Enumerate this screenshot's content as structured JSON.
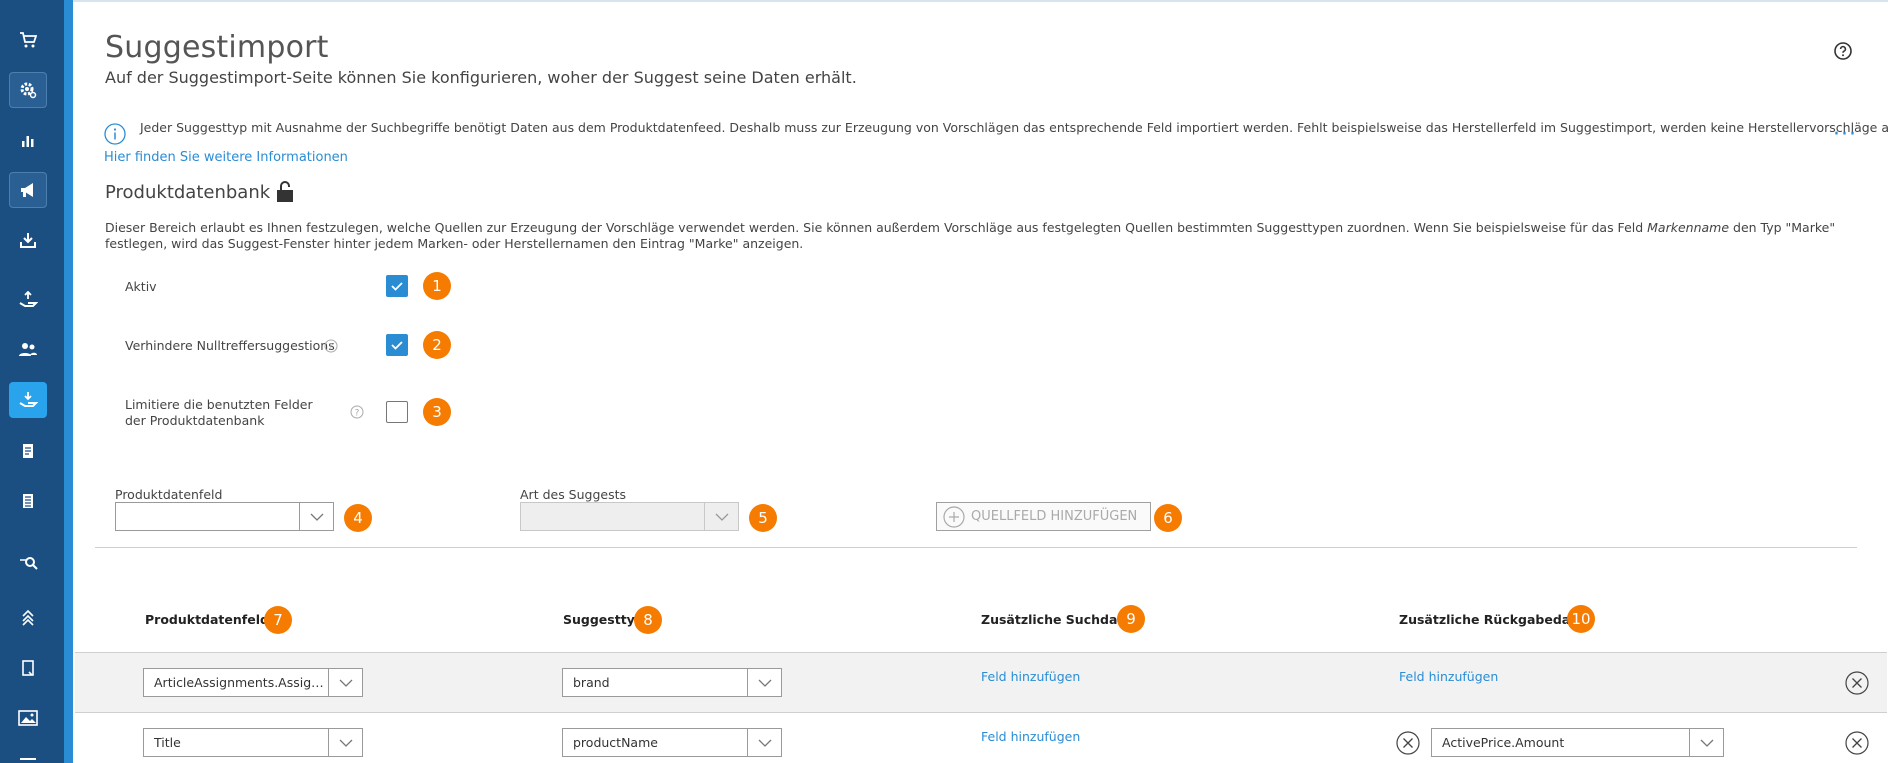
{
  "colors": {
    "sidebar": "#1b4f82",
    "accent": "#2a8dd4",
    "badge": "#f57c00",
    "active_nav": "#29a3ec"
  },
  "sidebar": {
    "items": [
      {
        "icon": "cart-icon"
      },
      {
        "icon": "settings-gear-icon"
      },
      {
        "icon": "bar-chart-icon"
      },
      {
        "icon": "megaphone-icon"
      },
      {
        "icon": "download-tray-icon"
      },
      {
        "icon": "hand-upload-icon"
      },
      {
        "icon": "users-icon"
      },
      {
        "icon": "hand-download-icon"
      },
      {
        "icon": "document-icon"
      },
      {
        "icon": "document-lines-icon"
      },
      {
        "icon": "search-tag-icon"
      },
      {
        "icon": "chevrons-up-icon"
      },
      {
        "icon": "page-icon"
      },
      {
        "icon": "image-icon"
      },
      {
        "icon": "list-icon"
      }
    ]
  },
  "header": {
    "title": "Suggestimport",
    "subtitle": "Auf der Suggestimport-Seite können Sie konfigurieren, woher der Suggest seine Daten erhält."
  },
  "info": {
    "text": "Jeder Suggesttyp mit Ausnahme der Suchbegriffe benötigt Daten aus dem Produktdatenfeed. Deshalb muss zur Erzeugung von Vorschlägen das entsprechende Feld importiert werden. Fehlt beispielsweise das Herstellerfeld im Suggestimport, werden keine Herstellervorschläge angezeigt.",
    "link": "Hier finden Sie weitere Informationen"
  },
  "section": {
    "title": "Produktdatenbank",
    "desc_part1": "Dieser Bereich erlaubt es Ihnen festzulegen, welche Quellen zur Erzeugung der Vorschläge verwendet werden. Sie können außerdem Vorschläge aus festgelegten Quellen bestimmten Suggesttypen zuordnen. Wenn Sie beispielsweise für das Feld ",
    "desc_italic": "Markenname",
    "desc_part2": " den Typ \"Marke\" festlegen, wird das Suggest-Fenster hinter jedem Marken- oder Herstellernamen den Eintrag \"Marke\" anzeigen."
  },
  "options": [
    {
      "label": "Aktiv",
      "checked": true,
      "badge": "1"
    },
    {
      "label": "Verhindere Nulltreffersuggestions",
      "checked": true,
      "badge": "2"
    },
    {
      "label": "Limitiere die benutzten Felder der Produktdatenbank",
      "checked": false,
      "badge": "3"
    }
  ],
  "add_form": {
    "field_label": "Produktdatenfeld",
    "field_value": "",
    "field_badge": "4",
    "type_label": "Art des Suggests",
    "type_value": "",
    "type_badge": "5",
    "add_button": "QUELLFELD HINZUFÜGEN",
    "add_badge": "6"
  },
  "table": {
    "columns": [
      {
        "label": "Produktdatenfeld",
        "badge": "7"
      },
      {
        "label": "Suggesttyp",
        "badge": "8"
      },
      {
        "label": "Zusätzliche Suchdaten",
        "badge": "9"
      },
      {
        "label": "Zusätzliche Rückgabedaten",
        "badge": "10"
      }
    ],
    "rows": [
      {
        "field": "ArticleAssignments.AssignmentName",
        "type": "brand",
        "search_link": "Feld hinzufügen",
        "return_link": "Feld hinzufügen"
      },
      {
        "field": "Title",
        "type": "productName",
        "search_link": "Feld hinzufügen",
        "return_value": "ActivePrice.Amount"
      }
    ]
  }
}
